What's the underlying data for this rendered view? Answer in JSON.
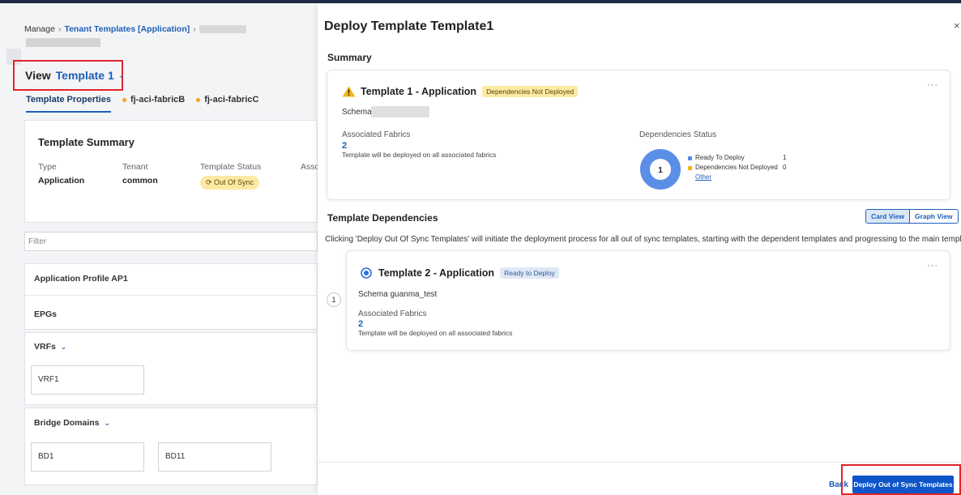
{
  "background": {
    "breadcrumb": {
      "root": "Manage",
      "section": "Tenant Templates [Application]"
    },
    "view": {
      "label": "View",
      "template": "Template 1"
    },
    "tabs": [
      {
        "label": "Template Properties",
        "active": true
      },
      {
        "label": "fj-aci-fabricB",
        "dot": "#f4a51c"
      },
      {
        "label": "fj-aci-fabricC",
        "dot": "#f4a51c"
      }
    ],
    "summary": {
      "title": "Template Summary",
      "type_label": "Type",
      "type_value": "Application",
      "tenant_label": "Tenant",
      "tenant_value": "common",
      "status_label": "Template Status",
      "status_value": "Out Of Sync",
      "assoc_label": "Asso"
    },
    "filter_placeholder": "Filter",
    "app_profile": "Application Profile AP1",
    "epgs": "EPGs",
    "vrfs": {
      "label": "VRFs",
      "items": [
        "VRF1"
      ]
    },
    "bridge_domains": {
      "label": "Bridge Domains",
      "items": [
        "BD1",
        "BD11"
      ]
    }
  },
  "drawer": {
    "title": "Deploy Template Template1",
    "close": "×",
    "summary_heading": "Summary",
    "main_card": {
      "title": "Template 1 - Application",
      "badge": "Dependencies Not Deployed",
      "schema_label": "Schema",
      "assoc_label": "Associated Fabrics",
      "assoc_count": "2",
      "assoc_note": "Template will be deployed on all associated fabrics",
      "dep_status_label": "Dependencies Status",
      "donut_center": "1",
      "legend": [
        {
          "label": "Ready To Deploy",
          "count": "1",
          "color": "#5b8ee6",
          "value": 1
        },
        {
          "label": "Dependencies Not Deployed",
          "count": "0",
          "color": "#f1b41c",
          "value": 0
        }
      ],
      "legend_other": "Other"
    },
    "deps_heading": "Template Dependencies",
    "view_toggle": {
      "card": "Card View",
      "graph": "Graph View"
    },
    "note": "Clicking 'Deploy Out Of Sync Templates' will initiate the deployment process for all out of sync templates, starting with the dependent templates and progressing to the main template.",
    "dep_step": "1",
    "dep_card": {
      "title": "Template 2 - Application",
      "badge": "Ready to Deploy",
      "schema": "Schema guanma_test",
      "assoc_label": "Associated Fabrics",
      "assoc_count": "2",
      "assoc_note": "Template will be deployed on all associated fabrics"
    },
    "footer": {
      "back": "Back",
      "deploy": "Deploy Out of Sync Templates"
    }
  },
  "colors": {
    "accent": "#1d5fb8",
    "highlight": "#e0242a",
    "primary_button": "#0d55c8",
    "warning": "#f4a51c"
  },
  "icons": [
    "chevron-down-icon",
    "warning-icon",
    "close-icon",
    "more-icon",
    "radio-icon"
  ]
}
